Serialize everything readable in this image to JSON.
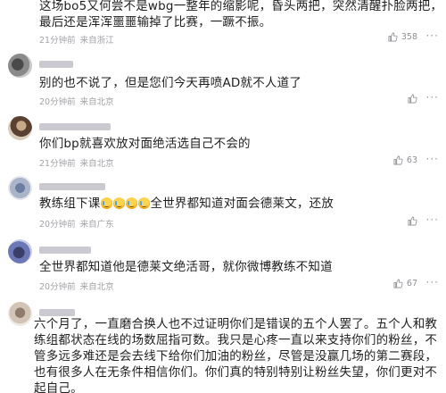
{
  "comments": [
    {
      "text_lines": [
        "这场bo5又何尝不是wbg一整年的缩影呢，昏头两把，突然清醒扑脸两把，",
        "最后还是浑浑噩噩输掉了比赛，一蹶不振。"
      ],
      "time": "21分钟前",
      "location": "来自浙江",
      "likes": "358"
    },
    {
      "text_lines": [
        "别的也不说了，但是您们今天再喷AD就不人道了"
      ],
      "time": "20分钟前",
      "location": "来自北京",
      "likes": ""
    },
    {
      "text_lines": [
        "你们bp就喜欢放对面绝活选自己不会的"
      ],
      "time": "21分钟前",
      "location": "来自北京",
      "likes": "63"
    },
    {
      "text_lines": [
        "教练组下课",
        "全世界都知道对面会德莱文，还放"
      ],
      "emoji_count": 4,
      "time": "20分钟前",
      "location": "来自广东",
      "likes": ""
    },
    {
      "text_lines": [
        "全世界都知道他是德莱文绝活哥，就你微博教练不知道"
      ],
      "time": "20分钟前",
      "location": "来自北京",
      "likes": "67"
    },
    {
      "text_lines": [
        "六个月了，一直磨合换人也不过证明你们是错误的五个人罢了。五个人和教",
        "练组都状态在线的场数屈指可数。我只是心疼一直以来支持你们的粉丝，不",
        "管多远多难还是会去线下给你们加油的粉丝，尽管是没赢几场的第二赛段，",
        "也有很多人在无条件相信你们。你们真的特别特别让粉丝失望，你们更对不",
        "起自己。"
      ]
    }
  ],
  "icons": {
    "like": "thumbs-up-icon",
    "more": "more-dots-icon",
    "emoji": "crying-laughing-emoji"
  },
  "more_glyph": "···"
}
